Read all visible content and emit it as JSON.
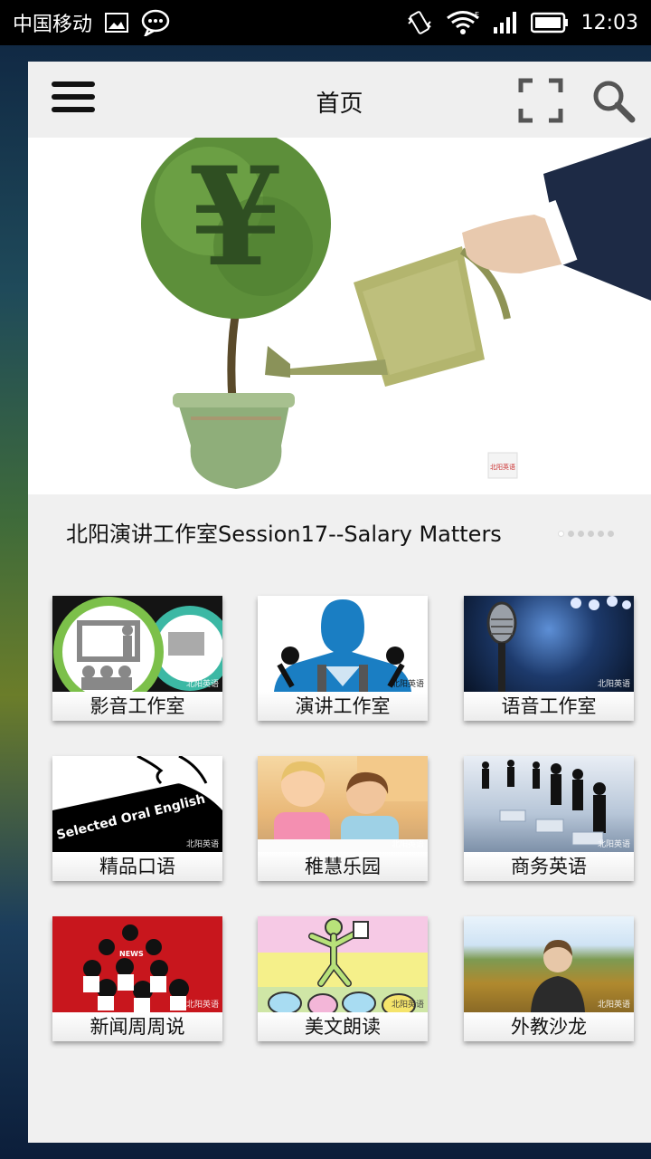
{
  "status_bar": {
    "carrier": "中国移动",
    "time": "12:03",
    "icons": [
      "image-icon",
      "chat-icon",
      "vibrate-icon",
      "wifi-icon",
      "signal-icon",
      "battery-icon"
    ]
  },
  "header": {
    "title": "首页",
    "icons": [
      "menu-icon",
      "scan-icon",
      "search-icon"
    ]
  },
  "banner": {
    "caption": "北阳演讲工作室Session17--Salary Matters",
    "logo_text": "北阳英语",
    "slides_count": 6,
    "active_slide": 1
  },
  "categories": [
    {
      "label": "影音工作室",
      "watermark": "北阳英语"
    },
    {
      "label": "演讲工作室",
      "watermark": "北阳英语"
    },
    {
      "label": "语音工作室",
      "watermark": "北阳英语"
    },
    {
      "label": "精品口语",
      "watermark": "北阳英语",
      "thumb_text": "Selected Oral English"
    },
    {
      "label": "稚慧乐园",
      "watermark": "北阳英语"
    },
    {
      "label": "商务英语",
      "watermark": "北阳英语"
    },
    {
      "label": "新闻周周说",
      "watermark": "北阳英语",
      "thumb_text": "NEWS"
    },
    {
      "label": "美文朗读",
      "watermark": "北阳英语"
    },
    {
      "label": "外教沙龙",
      "watermark": "北阳英语"
    }
  ],
  "colors": {
    "status_bar": "#000000",
    "header_bg": "#efefef",
    "app_bg": "#f0f0f0",
    "ring_green": "#7cc04a",
    "ring_teal": "#3cb8a4",
    "news_red": "#c8161d"
  }
}
